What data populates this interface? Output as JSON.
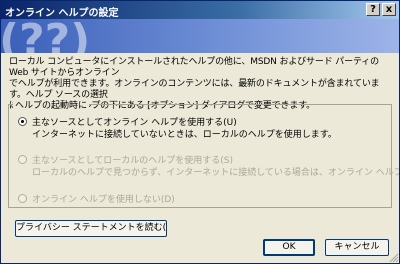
{
  "window": {
    "title": "オンライン ヘルプの設定",
    "help_button": "?",
    "close_button": "x"
  },
  "description": {
    "line1": "ローカル コンピュータにインストールされたヘルプの他に、MSDN およびサード パーティの Web サイトからオンライン",
    "line2": "でヘルプが利用できます。オンラインのコンテンツには、最新のドキュメントが含まれています。ヘルプ ソースの選択",
    "line3": "は、オンライン ヘルプの下にある [オプション] ダイアログで変更できます。"
  },
  "startup_group": {
    "label": "ヘルプの起動時に",
    "options": [
      {
        "label": "主なソースとしてオンライン ヘルプを使用する(U)",
        "detail": "インターネットに接続していないときは、ローカルのヘルプを使用します。",
        "selected": true,
        "enabled": true
      },
      {
        "label": "主なソースとしてローカルのヘルプを使用する(S)",
        "detail": "ローカルのヘルプで見つからず、インターネットに接続している場合は、オンライン ヘルプを使用します。",
        "selected": false,
        "enabled": false
      },
      {
        "label": "オンライン ヘルプを使用しない(D)",
        "selected": false,
        "enabled": false
      }
    ]
  },
  "buttons": {
    "privacy": "プライバシー ステートメントを読む(R)...",
    "ok": "OK",
    "cancel": "キャンセル"
  },
  "colors": {
    "dialog_bg": "#ece9d8",
    "titlebar": "#0a246a",
    "banner": "#3a5fb8",
    "disabled_text": "#aca899"
  },
  "icons": [
    "help-question-icon",
    "close-icon",
    "banner-help-icon",
    "resize-grip-icon"
  ]
}
